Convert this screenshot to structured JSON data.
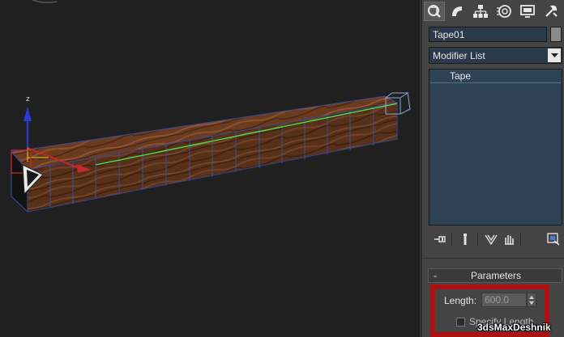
{
  "viewport": {
    "gizmo_axis_label": "z"
  },
  "command_panel": {
    "tabs": [
      {
        "name": "create",
        "icon": "create-icon",
        "active": true
      },
      {
        "name": "modify",
        "icon": "modify-icon",
        "active": false
      },
      {
        "name": "hierarchy",
        "icon": "hierarchy-icon",
        "active": false
      },
      {
        "name": "motion",
        "icon": "motion-icon",
        "active": false
      },
      {
        "name": "display",
        "icon": "display-icon",
        "active": false
      },
      {
        "name": "utilities",
        "icon": "utilities-icon",
        "active": false
      }
    ],
    "object_name": "Tape01",
    "object_color": "#8a8a8a",
    "modifier_list": "Modifier List",
    "stack_items": [
      "Tape"
    ],
    "stack_tools": [
      "pin-stack-icon",
      "show-end-result-icon",
      "make-unique-icon",
      "remove-modifier-icon",
      "configure-modifier-sets-icon"
    ]
  },
  "parameters": {
    "rollout_toggle": "-",
    "rollout_title": "Parameters",
    "length_label": "Length:",
    "length_value": "600.0",
    "specify_length_label": "Specify Length",
    "specify_length_checked": false
  },
  "colors": {
    "highlight": "#b00f0f",
    "tape_line": "#4de04d",
    "stack_bg": "#2e4355"
  },
  "watermark": "3dsMaxDeshnik"
}
